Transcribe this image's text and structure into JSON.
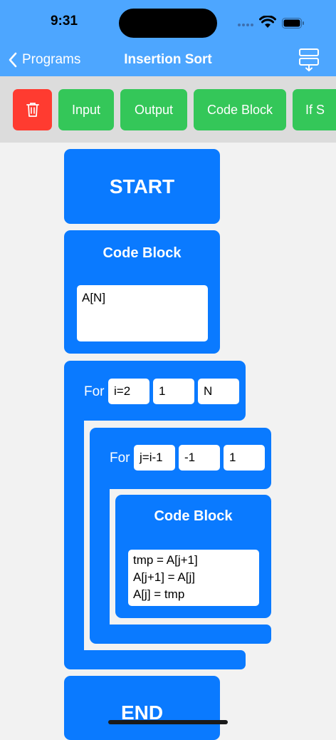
{
  "status_bar": {
    "time": "9:31"
  },
  "nav": {
    "back_label": "Programs",
    "title": "Insertion Sort"
  },
  "toolbar": {
    "items": [
      {
        "label": ""
      },
      {
        "label": "Input"
      },
      {
        "label": "Output"
      },
      {
        "label": "Code Block"
      },
      {
        "label": "If S"
      }
    ]
  },
  "flow": {
    "start_label": "START",
    "end_label": "END",
    "code_block_1": {
      "title": "Code Block",
      "code": "A[N]"
    },
    "for_outer": {
      "keyword": "For",
      "init": "i=2",
      "step": "1",
      "limit": "N"
    },
    "for_inner": {
      "keyword": "For",
      "init": "j=i-1",
      "step": "-1",
      "limit": "1"
    },
    "code_block_2": {
      "title": "Code Block",
      "lines": [
        "tmp = A[j+1]",
        "A[j+1] = A[j]",
        "A[j] = tmp"
      ]
    }
  },
  "colors": {
    "header": "#4da6ff",
    "block": "#0a7aff",
    "add_button": "#34c759",
    "delete_button": "#ff3b30",
    "toolbar_bg": "#dcdcdc"
  }
}
